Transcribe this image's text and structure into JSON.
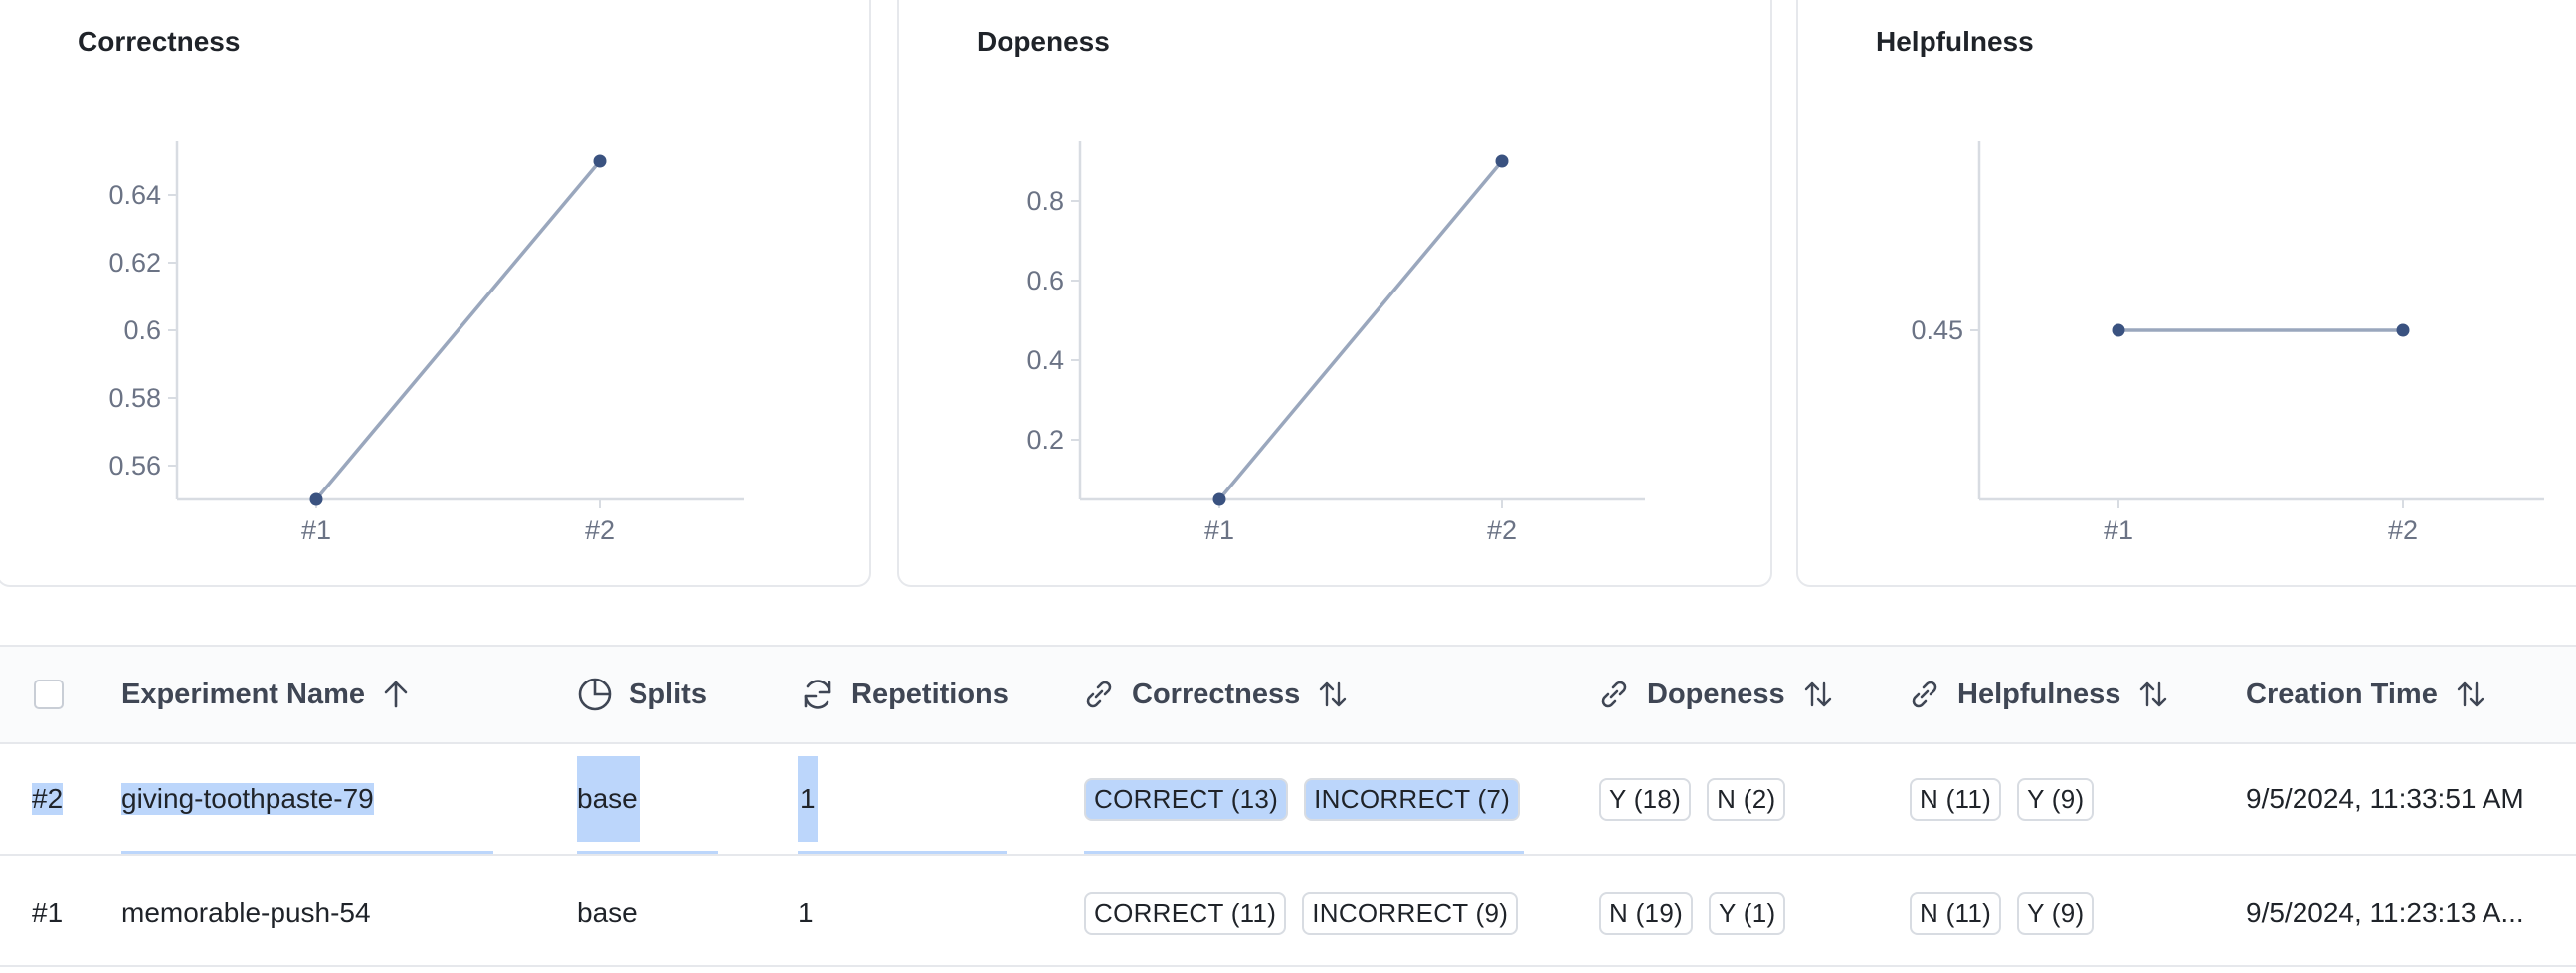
{
  "chart_data": [
    {
      "type": "line",
      "title": "Correctness",
      "categories": [
        "#1",
        "#2"
      ],
      "values": [
        0.55,
        0.65
      ],
      "yticks": [
        "0.56",
        "0.58",
        "0.6",
        "0.62",
        "0.64"
      ],
      "ytick_values": [
        0.56,
        0.58,
        0.6,
        0.62,
        0.64
      ],
      "ylim": [
        0.55,
        0.65
      ],
      "grid": false
    },
    {
      "type": "line",
      "title": "Dopeness",
      "categories": [
        "#1",
        "#2"
      ],
      "values": [
        0.05,
        0.9
      ],
      "yticks": [
        "0.2",
        "0.4",
        "0.6",
        "0.8"
      ],
      "ytick_values": [
        0.2,
        0.4,
        0.6,
        0.8
      ],
      "ylim": [
        0.05,
        0.9
      ],
      "grid": false
    },
    {
      "type": "line",
      "title": "Helpfulness",
      "categories": [
        "#1",
        "#2"
      ],
      "values": [
        0.45,
        0.45
      ],
      "yticks": [
        "0.45"
      ],
      "ytick_values": [
        0.45
      ],
      "ylim": [
        0.2,
        0.7
      ],
      "grid": false
    }
  ],
  "colors": {
    "line": "#9aa7bd",
    "point": "#3a5280",
    "axis": "#d8dce2"
  },
  "table": {
    "headers": {
      "name": "Experiment Name",
      "splits": "Splits",
      "repetitions": "Repetitions",
      "correctness": "Correctness",
      "dopeness": "Dopeness",
      "helpfulness": "Helpfulness",
      "created": "Creation Time"
    },
    "rows": [
      {
        "id": "#2",
        "name": "giving-toothpaste-79",
        "splits": "base",
        "repetitions": "1",
        "correctness": [
          "CORRECT (13)",
          "INCORRECT (7)"
        ],
        "dopeness": [
          "Y (18)",
          "N (2)"
        ],
        "helpfulness": [
          "N (11)",
          "Y (9)"
        ],
        "created": "9/5/2024, 11:33:51 AM"
      },
      {
        "id": "#1",
        "name": "memorable-push-54",
        "splits": "base",
        "repetitions": "1",
        "correctness": [
          "CORRECT (11)",
          "INCORRECT (9)"
        ],
        "dopeness": [
          "N (19)",
          "Y (1)"
        ],
        "helpfulness": [
          "N (11)",
          "Y (9)"
        ],
        "created": "9/5/2024, 11:23:13 A..."
      }
    ]
  }
}
